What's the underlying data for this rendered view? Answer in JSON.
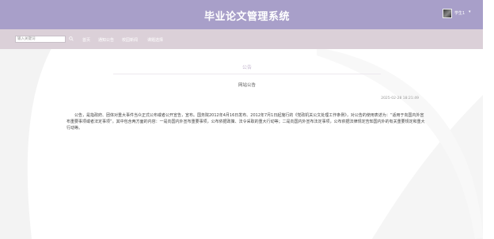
{
  "header": {
    "title": "毕业论文管理系统",
    "username": "学生1",
    "caret": "▾"
  },
  "navbar": {
    "search_placeholder": "输入关键词",
    "links": [
      "首页",
      "通知公告",
      "校园新闻",
      "课题选择"
    ]
  },
  "content": {
    "section_title": "公告",
    "article_title": "网站公告",
    "date": "2025-02-28 18:21:49",
    "body": "公告，是指政府、团体对重大事件当众正式公布或者公开宣告，宣布。国务院2012年4月16日发布、2012年7月1日起施行的《党政机关公文处理工作条例》，对公告的使用表述为：“适用于向国内外宣布重要事项或者法定事项”。其中包含两方面的内容：一是向国内外宣布重要事项，公布依据政策、法令采取的重大行动等；二是向国内外宣布法定事项，公布依据法律规定告知国内外的有关重要规定和重大行动等。"
  },
  "colors": {
    "header_bg": "#a89fc9",
    "navbar_bg": "#dbd0d8",
    "section_title": "#c5b8d0"
  }
}
